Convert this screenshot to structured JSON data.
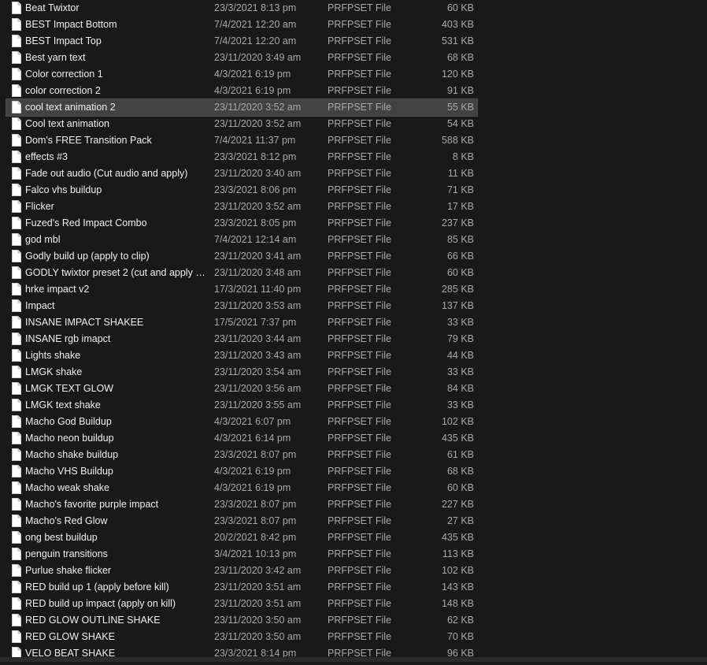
{
  "files": [
    {
      "name": "Beat Twixtor",
      "date": "23/3/2021 8:13 pm",
      "type": "PRFPSET File",
      "size": "60 KB"
    },
    {
      "name": "BEST Impact Bottom",
      "date": "7/4/2021 12:20 am",
      "type": "PRFPSET File",
      "size": "403 KB"
    },
    {
      "name": "BEST Impact Top",
      "date": "7/4/2021 12:20 am",
      "type": "PRFPSET File",
      "size": "531 KB"
    },
    {
      "name": "Best yarn text",
      "date": "23/11/2020 3:49 am",
      "type": "PRFPSET File",
      "size": "68 KB"
    },
    {
      "name": "Color correction 1",
      "date": "4/3/2021 6:19 pm",
      "type": "PRFPSET File",
      "size": "120 KB"
    },
    {
      "name": "color correction 2",
      "date": "4/3/2021 6:19 pm",
      "type": "PRFPSET File",
      "size": "91 KB"
    },
    {
      "name": "cool text animation 2",
      "date": "23/11/2020 3:52 am",
      "type": "PRFPSET File",
      "size": "55 KB",
      "selected": true
    },
    {
      "name": "Cool text animation",
      "date": "23/11/2020 3:52 am",
      "type": "PRFPSET File",
      "size": "54 KB"
    },
    {
      "name": "Dom's FREE Transition Pack",
      "date": "7/4/2021 11:37 pm",
      "type": "PRFPSET File",
      "size": "588 KB"
    },
    {
      "name": "effects #3",
      "date": "23/3/2021 8:12 pm",
      "type": "PRFPSET File",
      "size": "8 KB"
    },
    {
      "name": "Fade out audio (Cut audio and apply)",
      "date": "23/11/2020 3:40 am",
      "type": "PRFPSET File",
      "size": "11 KB"
    },
    {
      "name": "Falco vhs buildup",
      "date": "23/3/2021 8:06 pm",
      "type": "PRFPSET File",
      "size": "71 KB"
    },
    {
      "name": "Flicker",
      "date": "23/11/2020 3:52 am",
      "type": "PRFPSET File",
      "size": "17 KB"
    },
    {
      "name": "Fuzed's Red Impact Combo",
      "date": "23/3/2021 8:05 pm",
      "type": "PRFPSET File",
      "size": "237 KB"
    },
    {
      "name": "god mbl",
      "date": "7/4/2021 12:14 am",
      "type": "PRFPSET File",
      "size": "85 KB"
    },
    {
      "name": "Godly build up (apply to clip)",
      "date": "23/11/2020 3:41 am",
      "type": "PRFPSET File",
      "size": "66 KB"
    },
    {
      "name": "GODLY twixtor preset 2 (cut and apply 18...",
      "date": "23/11/2020 3:48 am",
      "type": "PRFPSET File",
      "size": "60 KB"
    },
    {
      "name": "hrke impact v2",
      "date": "17/3/2021 11:40 pm",
      "type": "PRFPSET File",
      "size": "285 KB"
    },
    {
      "name": "Impact",
      "date": "23/11/2020 3:53 am",
      "type": "PRFPSET File",
      "size": "137 KB"
    },
    {
      "name": "INSANE IMPACT SHAKEE",
      "date": "17/5/2021 7:37 pm",
      "type": "PRFPSET File",
      "size": "33 KB"
    },
    {
      "name": "INSANE rgb imapct",
      "date": "23/11/2020 3:44 am",
      "type": "PRFPSET File",
      "size": "79 KB"
    },
    {
      "name": "Lights shake",
      "date": "23/11/2020 3:43 am",
      "type": "PRFPSET File",
      "size": "44 KB"
    },
    {
      "name": "LMGK shake",
      "date": "23/11/2020 3:54 am",
      "type": "PRFPSET File",
      "size": "33 KB"
    },
    {
      "name": "LMGK TEXT GLOW",
      "date": "23/11/2020 3:56 am",
      "type": "PRFPSET File",
      "size": "84 KB"
    },
    {
      "name": "LMGK text shake",
      "date": "23/11/2020 3:55 am",
      "type": "PRFPSET File",
      "size": "33 KB"
    },
    {
      "name": "Macho God Buildup",
      "date": "4/3/2021 6:07 pm",
      "type": "PRFPSET File",
      "size": "102 KB"
    },
    {
      "name": "Macho neon buildup",
      "date": "4/3/2021 6:14 pm",
      "type": "PRFPSET File",
      "size": "435 KB"
    },
    {
      "name": "Macho shake buildup",
      "date": "23/3/2021 8:07 pm",
      "type": "PRFPSET File",
      "size": "61 KB"
    },
    {
      "name": "Macho VHS Buildup",
      "date": "4/3/2021 6:19 pm",
      "type": "PRFPSET File",
      "size": "68 KB"
    },
    {
      "name": "Macho weak shake",
      "date": "4/3/2021 6:19 pm",
      "type": "PRFPSET File",
      "size": "60 KB"
    },
    {
      "name": "Macho's favorite purple impact",
      "date": "23/3/2021 8:07 pm",
      "type": "PRFPSET File",
      "size": "227 KB"
    },
    {
      "name": "Macho's Red Glow",
      "date": "23/3/2021 8:07 pm",
      "type": "PRFPSET File",
      "size": "27 KB"
    },
    {
      "name": "ong best buildup",
      "date": "20/2/2021 8:42 pm",
      "type": "PRFPSET File",
      "size": "435 KB"
    },
    {
      "name": "penguin transitions",
      "date": "3/4/2021 10:13 pm",
      "type": "PRFPSET File",
      "size": "113 KB"
    },
    {
      "name": "Purlue shake flicker",
      "date": "23/11/2020 3:42 am",
      "type": "PRFPSET File",
      "size": "102 KB"
    },
    {
      "name": "RED build up 1 (apply before kill)",
      "date": "23/11/2020 3:51 am",
      "type": "PRFPSET File",
      "size": "143 KB"
    },
    {
      "name": "RED build up impact (apply on kill)",
      "date": "23/11/2020 3:51 am",
      "type": "PRFPSET File",
      "size": "148 KB"
    },
    {
      "name": "RED GLOW OUTLINE SHAKE",
      "date": "23/11/2020 3:50 am",
      "type": "PRFPSET File",
      "size": "62 KB"
    },
    {
      "name": "RED GLOW SHAKE",
      "date": "23/11/2020 3:50 am",
      "type": "PRFPSET File",
      "size": "70 KB"
    },
    {
      "name": "VELO BEAT SHAKE",
      "date": "23/3/2021 8:14 pm",
      "type": "PRFPSET File",
      "size": "96 KB"
    }
  ],
  "icon": "document-icon",
  "colors": {
    "background": "#191919",
    "selected_row": "#424242",
    "text_primary": "#f0f0f0",
    "text_secondary": "#a9a9a9"
  }
}
